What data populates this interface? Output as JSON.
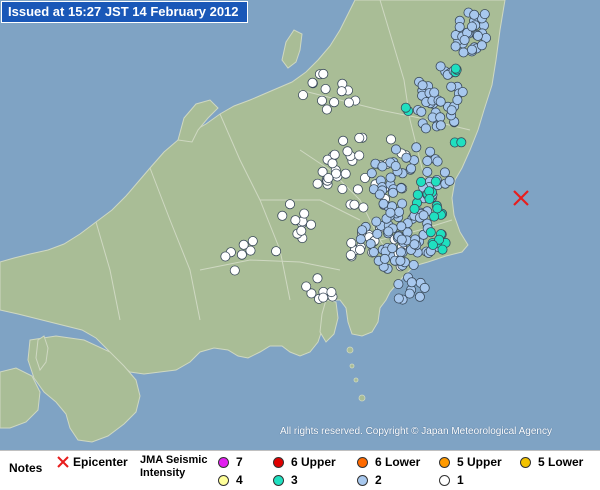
{
  "header": {
    "title": "Issued at 15:27 JST  14 February 2012"
  },
  "map": {
    "copyright": "All rights reserved. Copyright © Japan Meteorological Agency",
    "colors": {
      "sea": "#7fa3c4",
      "land": "#a9bd96",
      "border": "#cfd8c2"
    },
    "epicenter_marker_color": "#e81d1d"
  },
  "legend": {
    "notes_label": "Notes",
    "epicenter_label": "Epicenter",
    "scale_title_line1": "JMA Seismic",
    "scale_title_line2": "Intensity",
    "levels": [
      {
        "label": "7",
        "color": "#e21ff0"
      },
      {
        "label": "6 Upper",
        "color": "#e00000"
      },
      {
        "label": "6 Lower",
        "color": "#ff6a00"
      },
      {
        "label": "5 Upper",
        "color": "#ff9a00"
      },
      {
        "label": "5 Lower",
        "color": "#f2c200"
      },
      {
        "label": "4",
        "color": "#ffff99"
      },
      {
        "label": "3",
        "color": "#1fe0c0"
      },
      {
        "label": "2",
        "color": "#a8c8ee"
      },
      {
        "label": "1",
        "color": "#ffffff"
      }
    ]
  }
}
